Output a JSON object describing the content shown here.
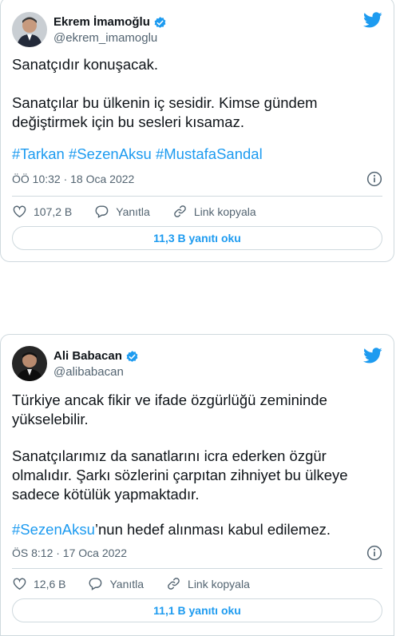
{
  "tweets": [
    {
      "author": "Ekrem İmamoğlu",
      "handle": "@ekrem_imamoglu",
      "paragraphs": [
        "Sanatçıdır konuşacak.",
        "Sanatçılar bu ülkenin iç sesidir. Kimse gündem değiştirmek için bu sesleri kısamaz."
      ],
      "hashtags": [
        "#Tarkan",
        "#SezenAksu",
        "#MustafaSandal"
      ],
      "time": "ÖÖ 10:32 · 18 Oca 2022",
      "likes": "107,2 B",
      "reply_label": "Yanıtla",
      "copy_link_label": "Link kopyala",
      "read_replies": "11,3 B yanıtı oku"
    },
    {
      "author": "Ali Babacan",
      "handle": "@alibabacan",
      "paragraphs": [
        "Türkiye ancak fikir ve ifade özgürlüğü zemininde yükselebilir.",
        "Sanatçılarımız da sanatlarını icra ederken özgür olmalıdır. Şarkı sözlerini çarpıtan zihniyet bu ülkeye sadece kötülük yapmaktadır."
      ],
      "hashtag": "#SezenAksu",
      "hashtag_suffix": "’nun hedef alınması kabul edilemez.",
      "time": "ÖS 8:12 · 17 Oca 2022",
      "likes": "12,6 B",
      "reply_label": "Yanıtla",
      "copy_link_label": "Link kopyala",
      "read_replies": "11,1 B yanıtı oku"
    }
  ],
  "colors": {
    "accent": "#1d9bf0",
    "secondary_text": "#536471",
    "border": "#cfd9de"
  },
  "icons": [
    "verified-badge-icon",
    "twitter-bird-icon",
    "info-icon",
    "heart-icon",
    "reply-bubble-icon",
    "link-icon"
  ]
}
